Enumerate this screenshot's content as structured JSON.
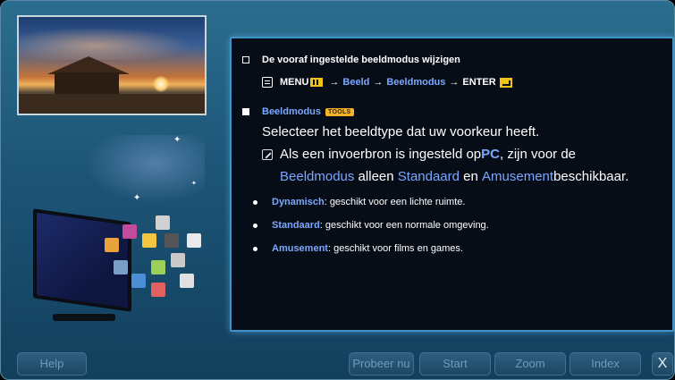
{
  "window": {
    "accent_border": "#3e94c8",
    "background": "#1d5577"
  },
  "content": {
    "heading": "De vooraf ingestelde beeldmodus wijzigen",
    "path": {
      "menu_label": "MENU",
      "arrow1": "→",
      "beeld": "Beeld",
      "arrow2": "→",
      "beeldmodus": "Beeldmodus",
      "arrow3": "→",
      "enter_label": "ENTER"
    },
    "section_title": "Beeldmodus",
    "tools_badge": "TOOLS",
    "description": "Selecteer het beeldtype dat uw voorkeur heeft.",
    "note": {
      "part1": "Als een invoerbron is ingesteld op ",
      "pc": "PC",
      "part2": ", zijn voor de",
      "beeldmodus": "Beeldmodus",
      "part3": " alleen ",
      "standaard": "Standaard",
      "part4": " en ",
      "amusement": "Amusement",
      "part5": " beschikbaar."
    },
    "bullets": [
      {
        "term": "Dynamisch",
        "text": ": geschikt voor een lichte ruimte."
      },
      {
        "term": "Standaard",
        "text": ": geschikt voor een normale omgeving."
      },
      {
        "term": "Amusement",
        "text": ": geschikt voor films en games."
      }
    ]
  },
  "icons": {
    "memo": "memo-icon",
    "menu": "menu-icon",
    "enter": "enter-icon",
    "note": "pencil-icon"
  },
  "bottombar": {
    "help": "Help",
    "try": "Probeer nu",
    "start": "Start",
    "zoom": "Zoom",
    "index": "Index",
    "close": "X"
  }
}
